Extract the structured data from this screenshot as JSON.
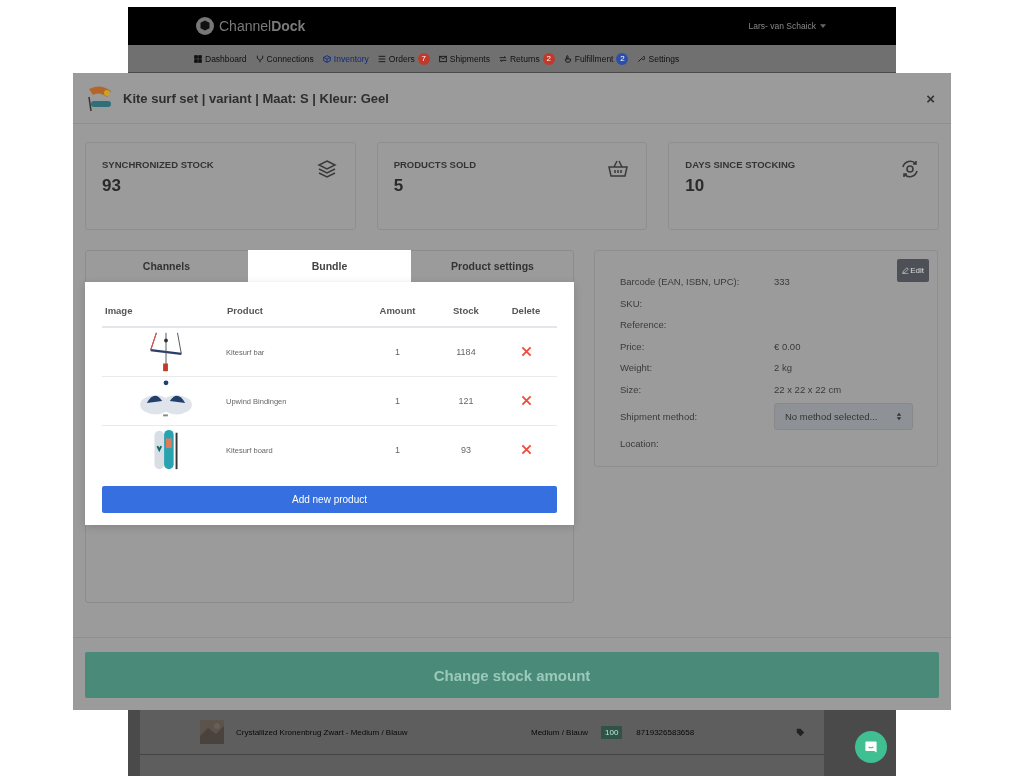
{
  "app": {
    "logo": "Channel**Dock**",
    "user": "Lars- van Schaick",
    "nav": [
      {
        "label": "Dashboard",
        "selected": false
      },
      {
        "label": "Connections",
        "selected": false
      },
      {
        "label": "Inventory",
        "selected": true
      },
      {
        "label": "Orders",
        "selected": false,
        "badge": "7",
        "color": "#c0392b"
      },
      {
        "label": "Shipments",
        "selected": false
      },
      {
        "label": "Returns",
        "selected": false,
        "badge": "2",
        "color": "#c0392b"
      },
      {
        "label": "Fulfillment",
        "selected": false,
        "badge": "2",
        "color": "#2c4fa8"
      },
      {
        "label": "Settings",
        "selected": false
      }
    ],
    "rows": [
      {
        "name": "Crystallized Kronenbrug Zwart - Medium / Blauw",
        "variant": "Medium / Blauw",
        "stock": "100",
        "ean": "8719326583658"
      }
    ]
  },
  "modal": {
    "title": "Kite surf set | variant | Maat: S | Kleur: Geel",
    "close": "×",
    "stats": [
      {
        "label": "SYNCHRONIZED STOCK",
        "value": "93"
      },
      {
        "label": "PRODUCTS SOLD",
        "value": "5"
      },
      {
        "label": "DAYS SINCE STOCKING",
        "value": "10"
      }
    ],
    "tabs": [
      {
        "label": "Channels",
        "selected": false
      },
      {
        "label": "Bundle",
        "selected": true
      },
      {
        "label": "Product settings",
        "selected": false
      }
    ],
    "table": {
      "columns": [
        "Image",
        "Product",
        "Amount",
        "Stock",
        "Delete"
      ],
      "rows": [
        {
          "kind": "picture",
          "product": "Kitesurf bar",
          "amount": "1",
          "stock": "1184"
        },
        {
          "kind": "picture",
          "product": "Upwind Bindingen",
          "amount": "1",
          "stock": "121"
        },
        {
          "kind": "picture",
          "product": "Kitesurf board",
          "amount": "1",
          "stock": "93"
        }
      ]
    },
    "add_button": "Add new product",
    "edit_button": "Edit",
    "details": [
      {
        "label": "Barcode (EAN, ISBN, UPC):",
        "value": "333"
      },
      {
        "label": "SKU:"
      },
      {
        "label": "Reference:"
      },
      {
        "label": "Price:",
        "value": "€ 0.00"
      },
      {
        "label": "Weight:",
        "value": "2 kg"
      },
      {
        "label": "Size:",
        "value": "22 x 22 x 22 cm"
      },
      {
        "label": "Shipment method:",
        "select": "No method selected..."
      },
      {
        "label": "Location:"
      }
    ],
    "footer_button": "Change stock amount"
  }
}
